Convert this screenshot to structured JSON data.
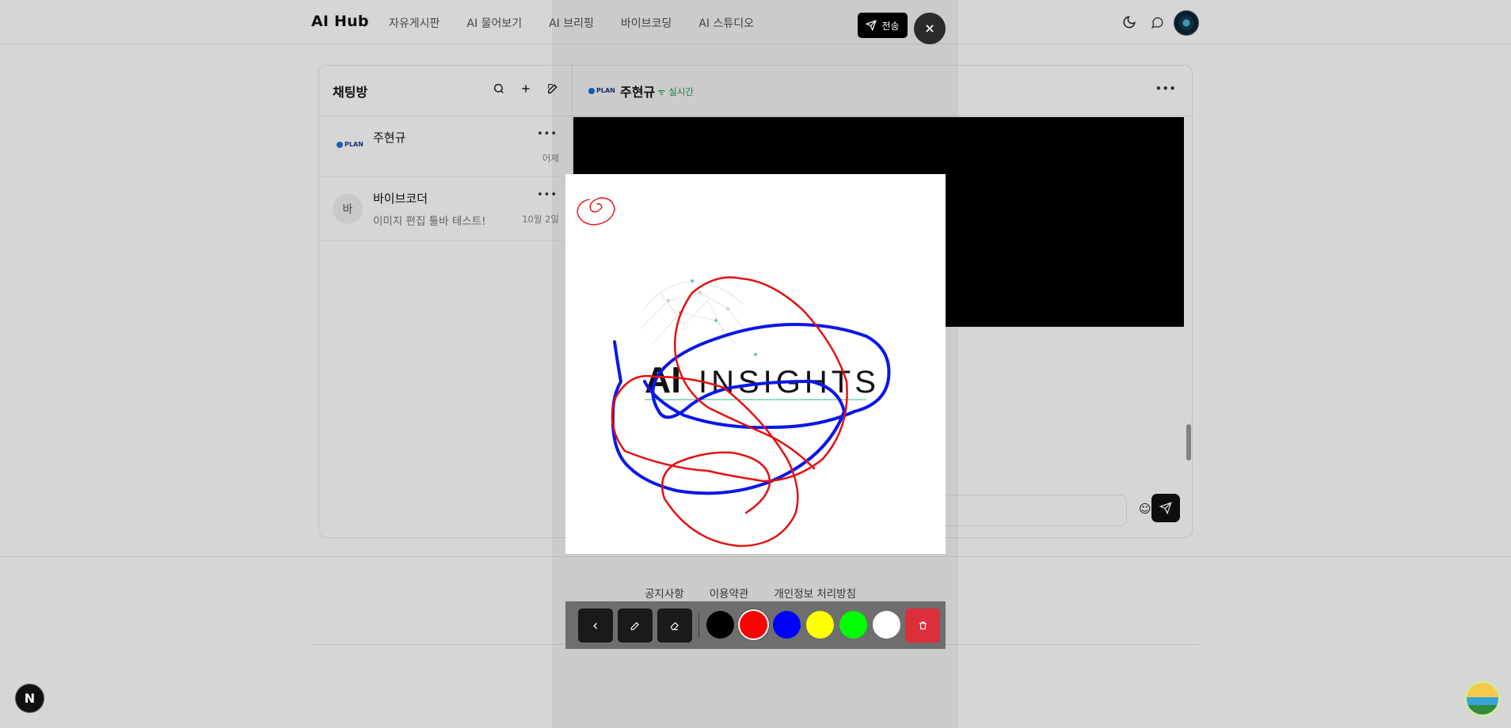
{
  "header": {
    "logo": "AI Hub",
    "nav": [
      "자유게시판",
      "AI 물어보기",
      "AI 브리핑",
      "바이브코딩",
      "AI 스튜디오"
    ]
  },
  "sidebar": {
    "title": "채팅방",
    "rooms": [
      {
        "name": "주현규",
        "preview": "",
        "time": "어제",
        "avatar_logo": "PLAN"
      },
      {
        "name": "바이브코더",
        "preview": "이미지 편집 툴바 테스트!",
        "time": "10월 2일",
        "avatar_text": "바"
      }
    ]
  },
  "chat": {
    "name": "주현규",
    "live": "실시간",
    "logo": "PLAN"
  },
  "footer": {
    "links": [
      "공지사항",
      "이용약관",
      "개인정보 처리방침"
    ]
  },
  "editor": {
    "send_label": "전송",
    "image_text": "AI INSIGHTS",
    "colors": [
      "#000000",
      "#ff0000",
      "#0000ff",
      "#ffff00",
      "#00ff00",
      "#ffffff"
    ],
    "selected_color": "#ff0000",
    "tools": [
      "back",
      "pen",
      "eraser"
    ]
  },
  "badges": {
    "next": "N"
  }
}
